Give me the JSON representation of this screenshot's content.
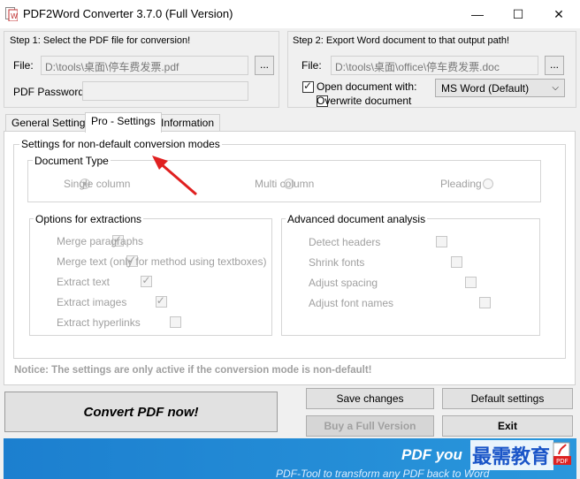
{
  "window": {
    "title": "PDF2Word Converter 3.7.0 (Full Version)",
    "minimize_glyph": "—",
    "maximize_glyph": "☐",
    "close_glyph": "✕"
  },
  "step1": {
    "heading": "Step 1: Select the PDF file for conversion!",
    "file_label": "File:",
    "file_value": "D:\\tools\\桌面\\停车费发票.pdf",
    "browse_label": "...",
    "password_label": "PDF Password:",
    "password_value": ""
  },
  "step2": {
    "heading": "Step 2: Export Word document to that output path!",
    "file_label": "File:",
    "file_value": "D:\\tools\\桌面\\office\\停车费发票.doc",
    "browse_label": "...",
    "open_doc_label": "Open document with:",
    "open_doc_checked": true,
    "overwrite_label": "Overwrite document",
    "overwrite_checked": false,
    "app_select_value": "MS Word (Default)"
  },
  "tabs": [
    {
      "label": "General Settings",
      "active": false
    },
    {
      "label": "Pro - Settings",
      "active": true
    },
    {
      "label": "Information",
      "active": false
    }
  ],
  "pro_settings": {
    "group_title": "Settings for non-default conversion modes",
    "doc_type": {
      "title": "Document Type",
      "options": [
        "Single column",
        "Multi column",
        "Pleading"
      ],
      "selected": "Single column"
    },
    "extractions": {
      "title": "Options for extractions",
      "items": [
        {
          "label": "Merge paragraphs",
          "checked": true
        },
        {
          "label": "Merge text (only for method using textboxes)",
          "checked": true
        },
        {
          "label": "Extract text",
          "checked": true
        },
        {
          "label": "Extract images",
          "checked": true
        },
        {
          "label": "Extract hyperlinks",
          "checked": false
        }
      ]
    },
    "analysis": {
      "title": "Advanced document analysis",
      "items": [
        {
          "label": "Detect headers",
          "checked": false
        },
        {
          "label": "Shrink fonts",
          "checked": false
        },
        {
          "label": "Adjust spacing",
          "checked": false
        },
        {
          "label": "Adjust font names",
          "checked": false
        }
      ]
    },
    "notice": "Notice: The settings are only active if the conversion mode is non-default!"
  },
  "actions": {
    "convert": "Convert PDF now!",
    "save": "Save changes",
    "defaults": "Default settings",
    "buy": "Buy a Full Version",
    "exit": "Exit"
  },
  "banner": {
    "headline": "PDF you",
    "tagline": "PDF-Tool to transform any PDF back to Word",
    "watermark": "最需教育"
  },
  "colors": {
    "banner": "#1e88d0",
    "arrow": "#e02020",
    "watermark": "#1a55c8"
  }
}
